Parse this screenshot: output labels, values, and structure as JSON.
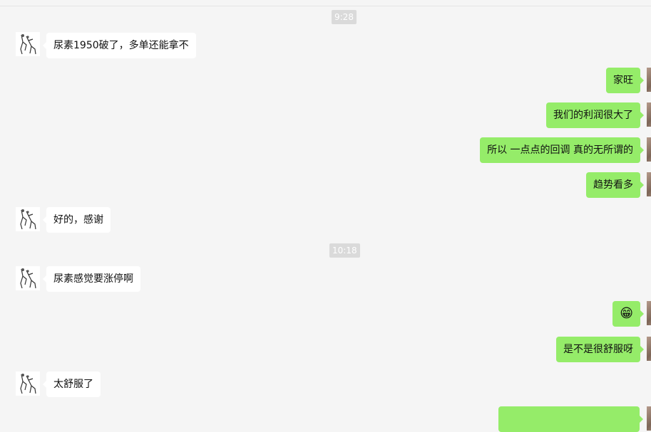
{
  "chat": {
    "timestamps": [
      "9:28",
      "10:18"
    ],
    "messages": [
      {
        "side": "left",
        "text": "尿素1950破了，多单还能拿不"
      },
      {
        "side": "right",
        "text": "家旺"
      },
      {
        "side": "right",
        "text": "我们的利润很大了"
      },
      {
        "side": "right",
        "text": "所以 一点点的回调  真的无所谓的"
      },
      {
        "side": "right",
        "text": "趋势看多"
      },
      {
        "side": "left",
        "text": "好的，感谢"
      },
      {
        "side": "left",
        "text": "尿素感觉要涨停啊"
      },
      {
        "side": "right",
        "text": "😁",
        "icon": "grinning-face-emoji"
      },
      {
        "side": "right",
        "text": "是不是很舒服呀"
      },
      {
        "side": "left",
        "text": "太舒服了"
      },
      {
        "side": "right",
        "text": ""
      }
    ]
  },
  "colors": {
    "background": "#f5f5f5",
    "incoming_bubble": "#ffffff",
    "outgoing_bubble": "#95ec69",
    "timestamp_bg": "#dadada"
  }
}
